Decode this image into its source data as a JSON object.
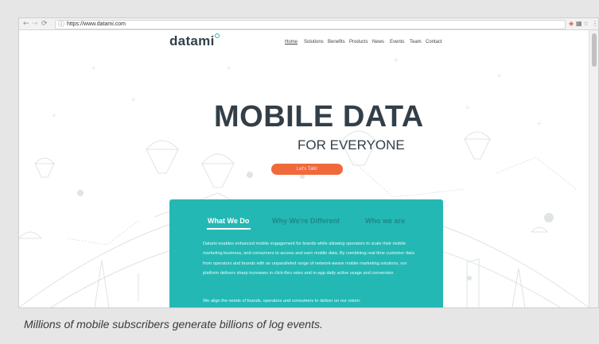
{
  "browser": {
    "back_icon": "arrow-left-icon",
    "forward_icon": "arrow-right-icon",
    "reload_icon": "reload-icon",
    "url": "https://www.datami.com"
  },
  "site": {
    "logo": "datami",
    "nav": [
      "Home",
      "Solutions",
      "Benefits",
      "Products",
      "News",
      "Events",
      "Team",
      "Contact"
    ]
  },
  "hero": {
    "title": "MOBILE DATA",
    "subtitle": "FOR EVERYONE",
    "cta": "Let's Talk!"
  },
  "panel": {
    "tabs": [
      "What We Do",
      "Why We're Different",
      "Who we are"
    ],
    "paragraph": "Datami enables enhanced mobile engagement for brands while allowing operators to scale their mobile marketing business, and consumers to access and earn mobile data. By combining real-time customer data from operators and brands with an unparalleled range of network-aware mobile marketing solutions, our platform delivers sharp increases in click-thru rates and in-app daily active usage and conversion.",
    "paragraph2": "We align the needs of brands, operators and consumers to deliver on our vision:"
  },
  "caption": "Millions of mobile subscribers generate billions of log events.",
  "colors": {
    "accent": "#24b8b4",
    "cta": "#f0693a",
    "dark": "#333f48"
  }
}
